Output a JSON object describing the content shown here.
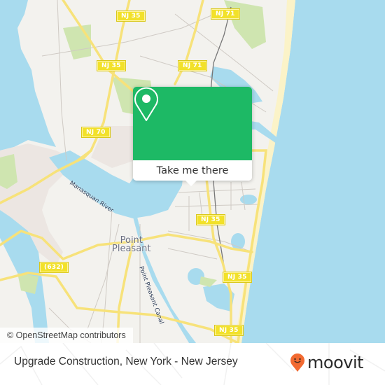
{
  "map": {
    "colors": {
      "land": "#f3f2ee",
      "water": "#a8dbee",
      "park": "#cfe5b0",
      "beach": "#fbf3c8",
      "highway": "#f7e27a",
      "road": "#cfcac4",
      "popup_green": "#1db965",
      "moovit_orange": "#f26a31"
    },
    "route_shields": [
      {
        "id": "nj35-top",
        "label": "NJ 35"
      },
      {
        "id": "nj71-top",
        "label": "NJ 71"
      },
      {
        "id": "nj35-mid",
        "label": "NJ 35"
      },
      {
        "id": "nj71-mid",
        "label": "NJ 71"
      },
      {
        "id": "nj70",
        "label": "NJ 70"
      },
      {
        "id": "nj35-east",
        "label": "NJ 35"
      },
      {
        "id": "cr632",
        "label": "(632)"
      },
      {
        "id": "nj35-south",
        "label": "NJ 35"
      },
      {
        "id": "nj35-bottom",
        "label": "NJ 35"
      }
    ],
    "place_labels": {
      "town": "Point\nPleasant",
      "town_line1": "Point",
      "town_line2": "Pleasant"
    },
    "water_labels": {
      "river": "Manasquan River",
      "canal": "Point Pleasant Canal"
    },
    "attribution": "© OpenStreetMap contributors"
  },
  "popup": {
    "icon": "map-pin-icon",
    "button_label": "Take me there"
  },
  "footer": {
    "title": "Upgrade Construction, New York - New Jersey",
    "brand": "moovit",
    "brand_icon": "moovit-pin-smiley-icon"
  }
}
